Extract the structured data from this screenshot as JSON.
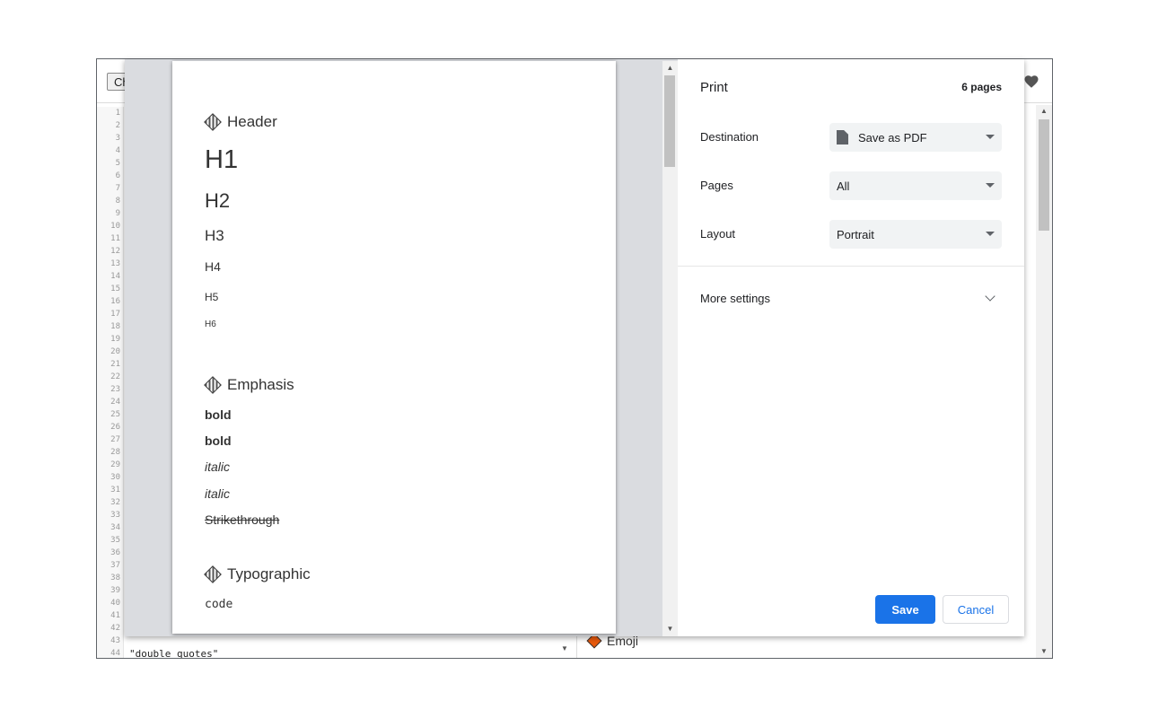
{
  "editor": {
    "button_label": "Ch",
    "line_numbers": [
      "1",
      "2",
      "3",
      "4",
      "5",
      "6",
      "7",
      "8",
      "9",
      "10",
      "11",
      "12",
      "13",
      "14",
      "15",
      "16",
      "17",
      "18",
      "19",
      "20",
      "21",
      "22",
      "23",
      "24",
      "25",
      "26",
      "27",
      "28",
      "29",
      "30",
      "31",
      "32",
      "33",
      "34",
      "35",
      "36",
      "37",
      "38",
      "39",
      "40",
      "41",
      "42",
      "43",
      "44"
    ],
    "last_line_text": "\"double quotes\""
  },
  "rendered_pane": {
    "emoji_heading": "Emoji"
  },
  "preview": {
    "header_heading": "Header",
    "h1": "H1",
    "h2": "H2",
    "h3": "H3",
    "h4": "H4",
    "h5": "H5",
    "h6": "H6",
    "emphasis_heading": "Emphasis",
    "bold_1": "bold",
    "bold_2": "bold",
    "italic_1": "italic",
    "italic_2": "italic",
    "strikethrough": "Strikethrough",
    "typographic_heading": "Typographic",
    "code": "code"
  },
  "print": {
    "title": "Print",
    "page_count": "6 pages",
    "destination_label": "Destination",
    "destination_value": "Save as PDF",
    "pages_label": "Pages",
    "pages_value": "All",
    "layout_label": "Layout",
    "layout_value": "Portrait",
    "more_settings_label": "More settings",
    "save_label": "Save",
    "cancel_label": "Cancel"
  },
  "colors": {
    "accent": "#1a73e8",
    "preview_background": "#dadce0",
    "emoji_diamond": "#e8590c"
  },
  "icons": {
    "favorite": "heart-icon",
    "destination": "file-icon",
    "expand": "chevron-down-icon"
  }
}
